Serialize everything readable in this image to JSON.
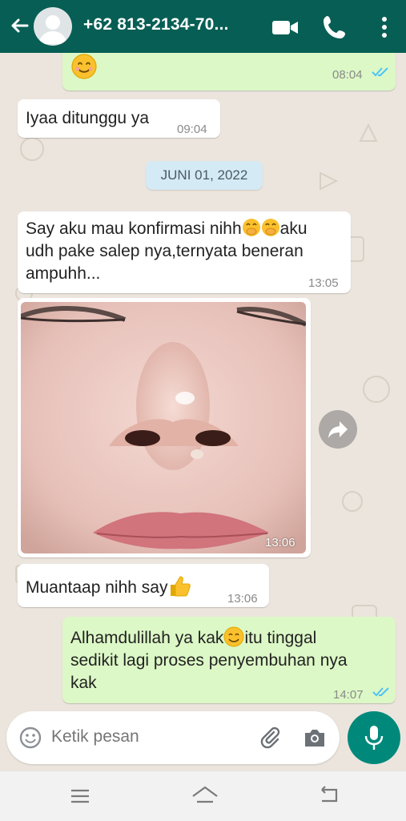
{
  "header": {
    "contact_name": "+62 813-2134-70...",
    "back_icon": "arrow-left-icon",
    "avatar_icon": "default-avatar-icon",
    "video_icon": "video-call-icon",
    "phone_icon": "voice-call-icon",
    "menu_icon": "more-vert-icon"
  },
  "messages": [
    {
      "type": "outgoing",
      "text": "",
      "emoji": "smiling-face",
      "time": "08:04",
      "status": "read"
    },
    {
      "type": "incoming",
      "text": "Iyaa ditunggu ya",
      "time": "09:04"
    },
    {
      "type": "date",
      "text": "JUNI 01, 2022"
    },
    {
      "type": "incoming",
      "line1": "Say aku mau konfirmasi nihh",
      "line1b": "aku",
      "line2": "udh pake salep nya,ternyata beneran",
      "line3": "ampuhh...",
      "time": "13:05"
    },
    {
      "type": "incoming-image",
      "time": "13:06"
    },
    {
      "type": "incoming",
      "text": "Muantaap nihh say",
      "emoji": "thumbs-up",
      "time": "13:06"
    },
    {
      "type": "outgoing",
      "line1": "Alhamdulillah ya kak",
      "line1b": "itu tinggal",
      "line2": "sedikit lagi proses penyembuhan nya",
      "line3": "kak",
      "time": "14:07",
      "status": "read"
    }
  ],
  "input": {
    "placeholder": "Ketik pesan",
    "emoji_icon": "emoji-icon",
    "attach_icon": "paperclip-icon",
    "camera_icon": "camera-icon",
    "mic_icon": "microphone-icon"
  },
  "colors": {
    "header": "#075e54",
    "outgoing_bubble": "#dcf8c6",
    "incoming_bubble": "#ffffff",
    "read_ticks": "#4fc3f7",
    "mic_button": "#00897b"
  }
}
